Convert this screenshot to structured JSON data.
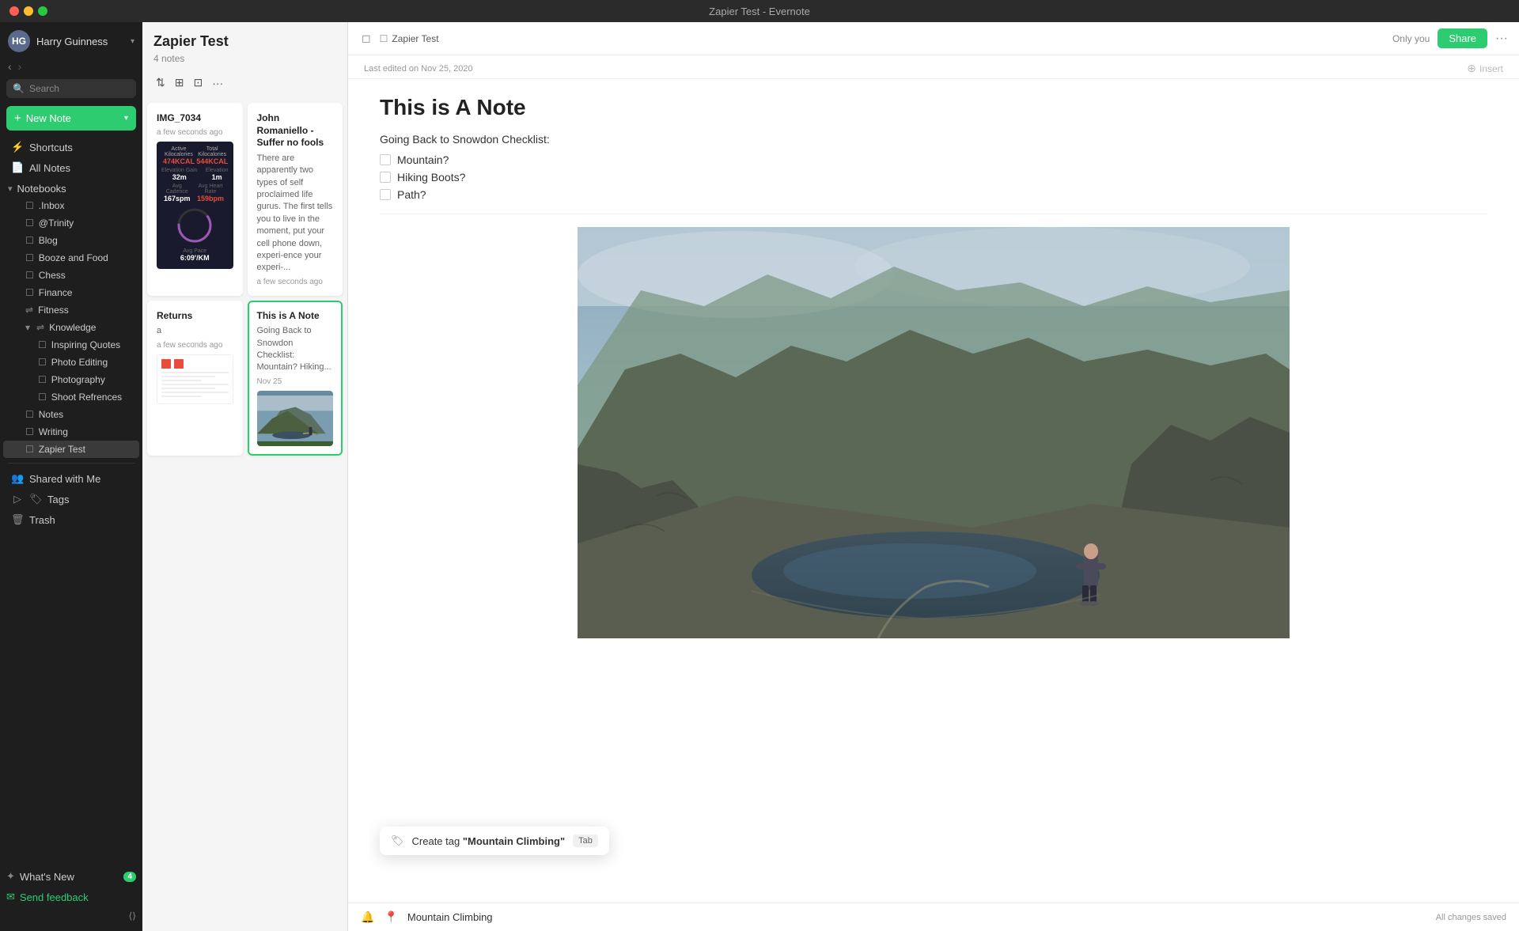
{
  "titleBar": {
    "title": "Zapier Test - Evernote"
  },
  "sidebar": {
    "user": {
      "name": "Harry Guinness",
      "initials": "HG"
    },
    "search": {
      "placeholder": "Search",
      "label": "Search"
    },
    "newNote": {
      "label": "New Note",
      "plus": "+"
    },
    "navItems": [
      {
        "label": "Shortcuts",
        "icon": "⚡"
      },
      {
        "label": "All Notes",
        "icon": "📄"
      }
    ],
    "notebooks": {
      "sectionLabel": "Notebooks",
      "items": [
        {
          "label": ".Inbox",
          "indent": 1
        },
        {
          "label": "@Trinity",
          "indent": 1
        },
        {
          "label": "Blog",
          "indent": 1
        },
        {
          "label": "Booze and Food",
          "indent": 1
        },
        {
          "label": "Chess",
          "indent": 1
        },
        {
          "label": "Finance",
          "indent": 1
        },
        {
          "label": "Fitness",
          "indent": 1
        },
        {
          "label": "Knowledge",
          "indent": 1,
          "expanded": true
        },
        {
          "label": "Inspiring Quotes",
          "indent": 2
        },
        {
          "label": "Photo Editing",
          "indent": 2
        },
        {
          "label": "Photography",
          "indent": 2
        },
        {
          "label": "Shoot Refrences",
          "indent": 2
        },
        {
          "label": "Notes",
          "indent": 1
        },
        {
          "label": "Writing",
          "indent": 1
        },
        {
          "label": "Zapier Test",
          "indent": 1,
          "active": true
        }
      ]
    },
    "sharedWithMe": {
      "label": "Shared with Me",
      "icon": "👥"
    },
    "tags": {
      "label": "Tags",
      "icon": "🏷"
    },
    "trash": {
      "label": "Trash",
      "icon": "🗑"
    },
    "whatsNew": {
      "label": "What's New",
      "badge": "4"
    },
    "sendFeedback": {
      "label": "Send feedback"
    }
  },
  "notesPanel": {
    "title": "Zapier Test",
    "count": "4 notes",
    "notes": [
      {
        "id": "note-1",
        "title": "IMG_7034",
        "excerpt": "",
        "date": "a few seconds ago",
        "hasFitnessThumb": true
      },
      {
        "id": "note-2",
        "title": "John Romaniello - Suffer no fools",
        "excerpt": "There are apparently two types of self proclaimed life gurus. The first tells you to live in the moment, put your cell phone down, experi-ence your experi-...",
        "date": "a few seconds ago",
        "hasFitnessThumb": false
      },
      {
        "id": "note-3",
        "title": "Returns",
        "excerpt": "a",
        "date": "a few seconds ago",
        "hasDocThumb": true
      },
      {
        "id": "note-4",
        "title": "This is A Note",
        "excerpt": "Going Back to Snowdon Checklist: Mountain? Hiking...",
        "date": "Nov 25",
        "hasSnowdonThumb": true,
        "active": true
      }
    ]
  },
  "editor": {
    "toolbar": {
      "notebookLabel": "Zapier Test",
      "onlyYouLabel": "Only you",
      "shareLabel": "Share"
    },
    "meta": {
      "lastEdited": "Last edited on Nov 25, 2020",
      "insertLabel": "Insert"
    },
    "note": {
      "title": "This is A Note",
      "checklistLabel": "Going Back to Snowdon Checklist:",
      "checklistItems": [
        {
          "text": "Mountain?",
          "checked": false
        },
        {
          "text": "Hiking Boots?",
          "checked": false
        },
        {
          "text": "Path?",
          "checked": false
        }
      ]
    },
    "tagPopup": {
      "createLabel": "Create tag",
      "tagName": "\"Mountain Climbing\"",
      "shortcut": "Tab"
    },
    "bottomBar": {
      "tagInputValue": "Mountain Climbing",
      "savedStatus": "All changes saved"
    }
  }
}
